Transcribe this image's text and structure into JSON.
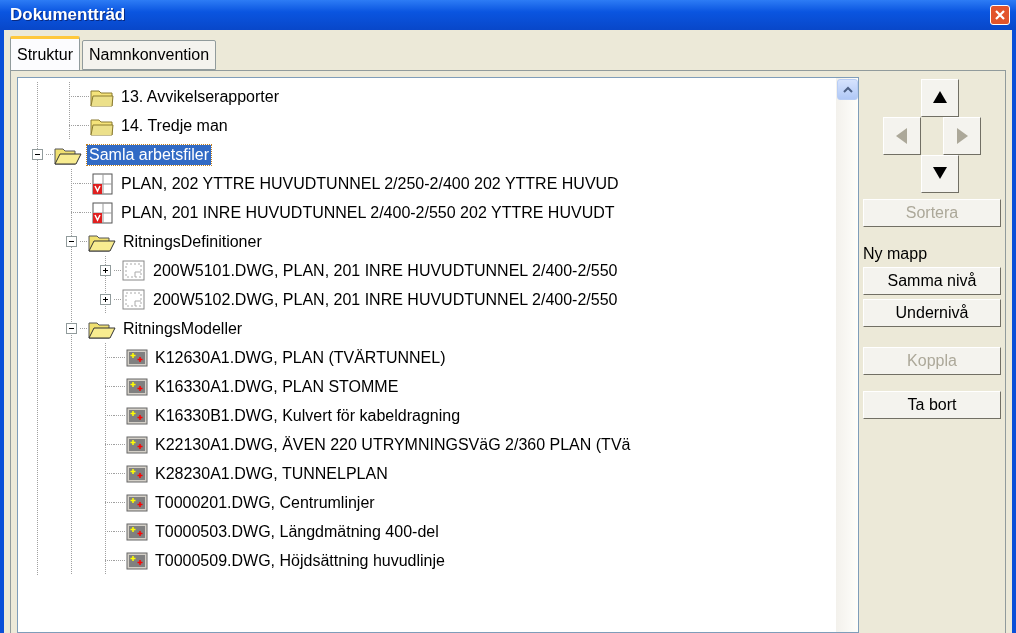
{
  "window": {
    "title": "Dokumentträd"
  },
  "tabs": [
    {
      "label": "Struktur",
      "selected": true
    },
    {
      "label": "Namnkonvention",
      "selected": false
    }
  ],
  "tree": {
    "continued_items": [
      {
        "label": "13. Avvikelserapporter",
        "kind": "folder",
        "selected": false
      },
      {
        "label": "14. Tredje man",
        "kind": "folder",
        "selected": false
      }
    ],
    "items": [
      {
        "label": "Samla arbetsfiler",
        "kind": "folder-open",
        "selected": true,
        "expanded": true,
        "children": [
          {
            "label": "PLAN, 202 YTTRE HUVUDTUNNEL 2/250-2/400 202 YTTRE HUVUD",
            "kind": "document",
            "selected": false
          },
          {
            "label": "PLAN, 201 INRE HUVUDTUNNEL 2/400-2/550 202 YTTRE HUVUDT",
            "kind": "document",
            "selected": false
          },
          {
            "label": "RitningsDefinitioner",
            "kind": "folder-open",
            "selected": false,
            "expanded": true,
            "children": [
              {
                "label": "200W5101.DWG, PLAN, 201 INRE HUVUDTUNNEL 2/400-2/550",
                "kind": "drawing",
                "selected": false,
                "expanded": false
              },
              {
                "label": "200W5102.DWG, PLAN, 201 INRE HUVUDTUNNEL 2/400-2/550",
                "kind": "drawing",
                "selected": false,
                "expanded": false
              }
            ]
          },
          {
            "label": "RitningsModeller",
            "kind": "folder-open",
            "selected": false,
            "expanded": true,
            "children": [
              {
                "label": "K12630A1.DWG, PLAN (TVÄRTUNNEL)",
                "kind": "model",
                "selected": false
              },
              {
                "label": "K16330A1.DWG, PLAN STOMME",
                "kind": "model",
                "selected": false
              },
              {
                "label": "K16330B1.DWG, Kulvert för kabeldragning",
                "kind": "model",
                "selected": false
              },
              {
                "label": "K22130A1.DWG, ÄVEN 220 UTRYMNINGSVäG 2/360 PLAN (TVä",
                "kind": "model",
                "selected": false
              },
              {
                "label": "K28230A1.DWG, TUNNELPLAN",
                "kind": "model",
                "selected": false
              },
              {
                "label": "T0000201.DWG, Centrumlinjer",
                "kind": "model",
                "selected": false
              },
              {
                "label": "T0000503.DWG, Längdmätning 400-del",
                "kind": "model",
                "selected": false
              },
              {
                "label": "T0000509.DWG, Höjdsättning huvudlinje",
                "kind": "model",
                "selected": false
              }
            ]
          }
        ]
      }
    ]
  },
  "move_buttons": [
    {
      "kind": "up",
      "disabled": false
    },
    {
      "kind": "left",
      "disabled": true
    },
    {
      "kind": "right",
      "disabled": true
    },
    {
      "kind": "down",
      "disabled": false
    }
  ],
  "sort_button": {
    "label": "Sortera",
    "disabled": true
  },
  "new_folder": {
    "label": "Ny mapp",
    "buttons": [
      {
        "label": "Samma nivå",
        "disabled": false
      },
      {
        "label": "Undernivå",
        "disabled": false
      }
    ]
  },
  "actions": [
    {
      "label": "Koppla",
      "disabled": true
    },
    {
      "label": "Ta bort",
      "disabled": false
    }
  ]
}
